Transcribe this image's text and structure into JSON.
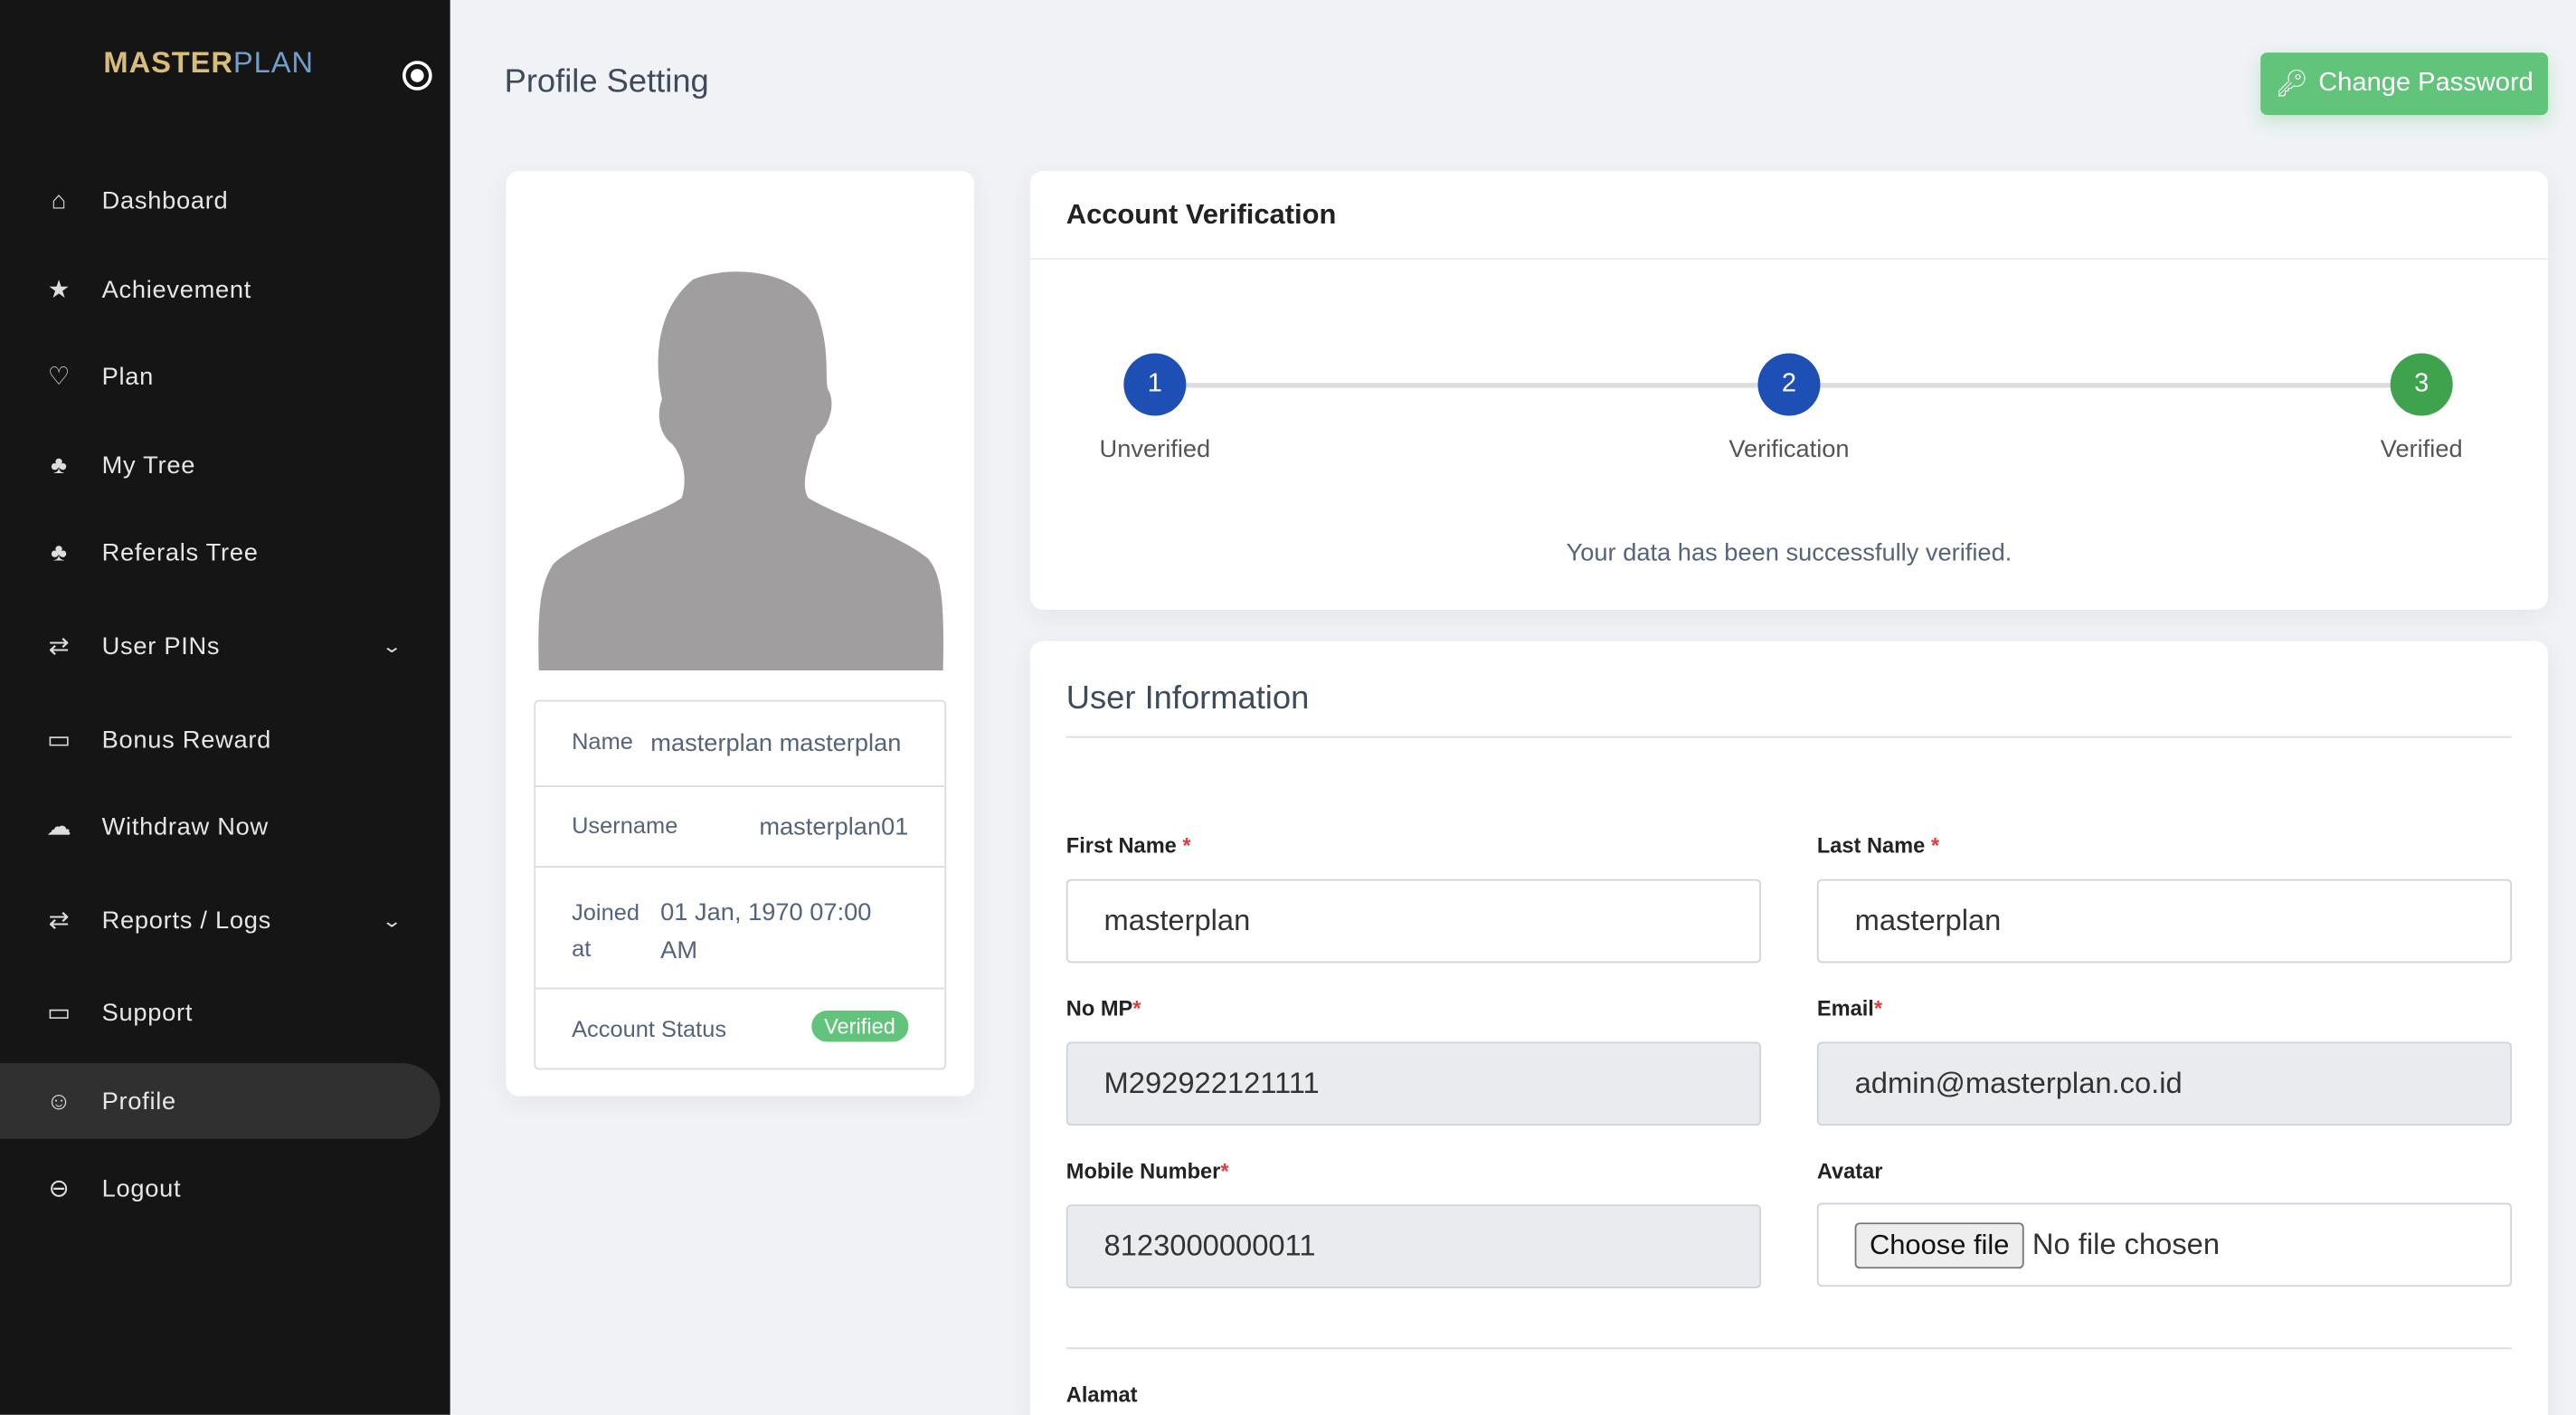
{
  "sidebar": {
    "logo_a": "MASTER",
    "logo_b": "PLAN",
    "items": [
      {
        "label": "Dashboard",
        "icon": "home-icon"
      },
      {
        "label": "Achievement",
        "icon": "star-icon"
      },
      {
        "label": "Plan",
        "icon": "lightbulb-icon"
      },
      {
        "label": "My Tree",
        "icon": "tree-icon"
      },
      {
        "label": "Referals Tree",
        "icon": "tree-icon"
      },
      {
        "label": "User PINs",
        "icon": "swap-icon",
        "has_submenu": true
      },
      {
        "label": "Bonus Reward",
        "icon": "scroll-icon"
      },
      {
        "label": "Withdraw Now",
        "icon": "cloud-download-icon"
      },
      {
        "label": "Reports / Logs",
        "icon": "swap-icon",
        "has_submenu": true
      },
      {
        "label": "Support",
        "icon": "ticket-icon"
      },
      {
        "label": "Profile",
        "icon": "user-icon",
        "active": true
      },
      {
        "label": "Logout",
        "icon": "logout-icon"
      }
    ]
  },
  "header": {
    "title": "Profile Setting",
    "change_password": "Change Password"
  },
  "profile": {
    "rows": [
      {
        "label": "Name",
        "value": "masterplan masterplan"
      },
      {
        "label": "Username",
        "value": "masterplan01"
      },
      {
        "label": "Joined at",
        "value": "01 Jan, 1970 07:00 AM"
      },
      {
        "label": "Account Status",
        "value": "Verified"
      }
    ]
  },
  "verification": {
    "title": "Account Verification",
    "steps": [
      {
        "num": "1",
        "label": "Unverified",
        "color": "#1e4fb5"
      },
      {
        "num": "2",
        "label": "Verification",
        "color": "#1e4fb5"
      },
      {
        "num": "3",
        "label": "Verified",
        "color": "#3fa34d"
      }
    ],
    "message": "Your data has been successfully verified."
  },
  "user_info": {
    "title": "User Information",
    "first_name": {
      "label": "First Name",
      "value": "masterplan"
    },
    "last_name": {
      "label": "Last Name",
      "value": "masterplan"
    },
    "no_mp": {
      "label": "No MP",
      "value": "M292922121111"
    },
    "email": {
      "label": "Email",
      "value": "admin@masterplan.co.id"
    },
    "mobile": {
      "label": "Mobile Number",
      "value": "8123000000011"
    },
    "avatar": {
      "label": "Avatar",
      "button": "Choose file",
      "status": "No file chosen"
    },
    "alamat": {
      "label": "Alamat"
    }
  },
  "colors": {
    "sidebar": "#151515",
    "accent_green": "#62c37a",
    "step_blue": "#1e4fb5"
  }
}
